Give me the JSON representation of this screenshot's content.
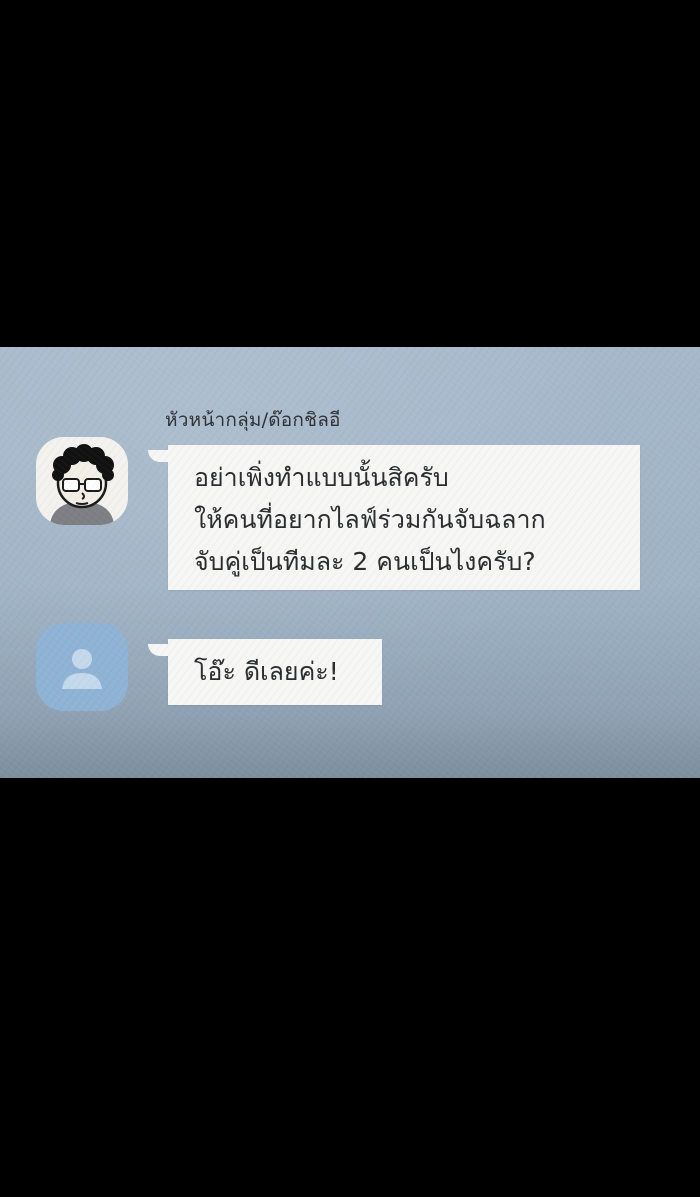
{
  "chat": {
    "messages": [
      {
        "sender": "หัวหน้ากลุ่ม/ด๊อกชิลอี",
        "avatar_icon": "curly-hair-glasses-avatar-icon",
        "lines": [
          "อย่าเพิ่งทำแบบนั้นสิครับ",
          "ให้คนที่อยากไลฟ์ร่วมกันจับฉลาก",
          "จับคู่เป็นทีมละ 2 คนเป็นไงครับ?"
        ]
      },
      {
        "avatar_icon": "default-user-avatar-icon",
        "lines": [
          "โอ๊ะ ดีเลยค่ะ!"
        ]
      }
    ]
  },
  "colors": {
    "panel": "#a6b9cb",
    "bubble": "#f6f6f4",
    "default_avatar": "#8fb4d6",
    "background": "#000000"
  }
}
